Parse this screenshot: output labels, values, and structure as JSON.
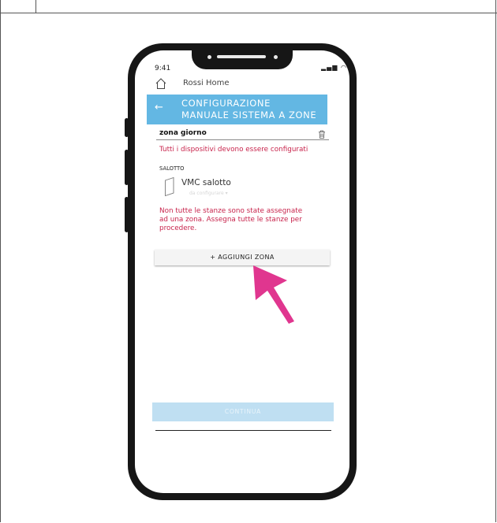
{
  "status_bar": {
    "time": "9:41",
    "icons": "signal-wifi-battery"
  },
  "app": {
    "home_title": "Rossi Home"
  },
  "header": {
    "back_icon": "arrow-left-icon",
    "title": "CONFIGURAZIONE\nMANUALE SISTEMA A ZONE"
  },
  "zone": {
    "name": "zona giorno",
    "warning": "Tutti i dispositivi devono essere configurati",
    "room_label": "SALOTTO",
    "device_name": "VMC  salotto",
    "device_status": "da configurare ▾"
  },
  "assign_warning": "Non tutte le stanze sono state assegnate ad una zona. Assegna tutte le stanze per procedere.",
  "buttons": {
    "add_zone": "+  AGGIUNGI ZONA",
    "continue": "CONTINUA"
  },
  "colors": {
    "header": "#63b7e3",
    "warning": "#c8244c",
    "continue_disabled": "#bfdff2",
    "pointer_arrow": "#e0368f"
  }
}
